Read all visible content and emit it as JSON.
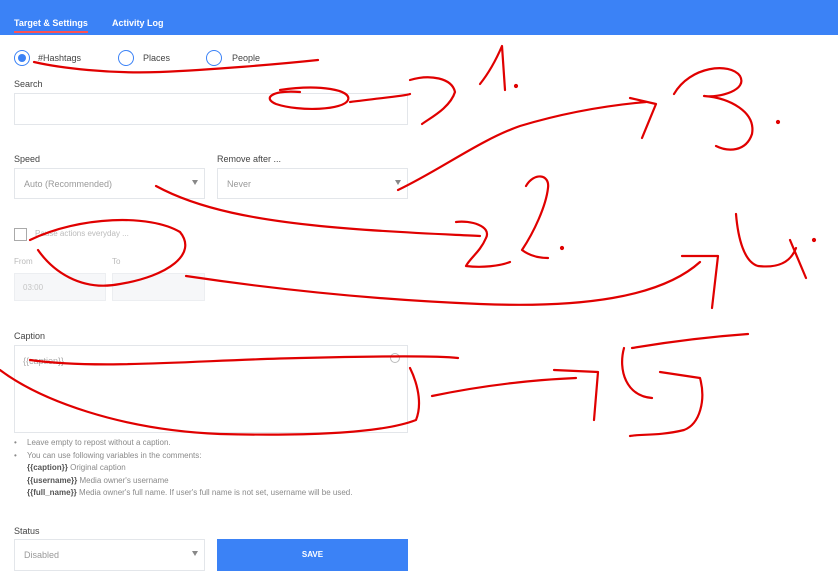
{
  "tabs": [
    {
      "label": "Target & Settings",
      "active": true
    },
    {
      "label": "Activity Log",
      "active": false
    }
  ],
  "target_type": {
    "options": [
      "#Hashtags",
      "Places",
      "People"
    ],
    "selected": "#Hashtags"
  },
  "search": {
    "label": "Search",
    "value": ""
  },
  "speed": {
    "label": "Speed",
    "value": "Auto (Recommended)"
  },
  "remove_after": {
    "label": "Remove after ...",
    "value": "Never"
  },
  "pause": {
    "label": "Pause actions everyday ...",
    "checked": false,
    "from_label": "From",
    "to_label": "To",
    "from_value": "03:00"
  },
  "caption": {
    "label": "Caption",
    "placeholder": "{{caption}}",
    "help": {
      "line1": "Leave empty to repost without a caption.",
      "line2": "You can use following variables in the comments:",
      "vars": [
        {
          "name": "{{caption}}",
          "desc": "Original caption"
        },
        {
          "name": "{{username}}",
          "desc": "Media owner's username"
        },
        {
          "name": "{{full_name}}",
          "desc": "Media owner's full name. If user's full name is not set, username will be used."
        }
      ]
    }
  },
  "status": {
    "label": "Status",
    "value": "Disabled"
  },
  "save_label": "SAVE",
  "annotations": [
    "1",
    "2",
    "3",
    "4",
    "5"
  ],
  "colors": {
    "accent": "#3b82f6",
    "tab_underline": "#ff5252",
    "annotation": "#e00000"
  }
}
